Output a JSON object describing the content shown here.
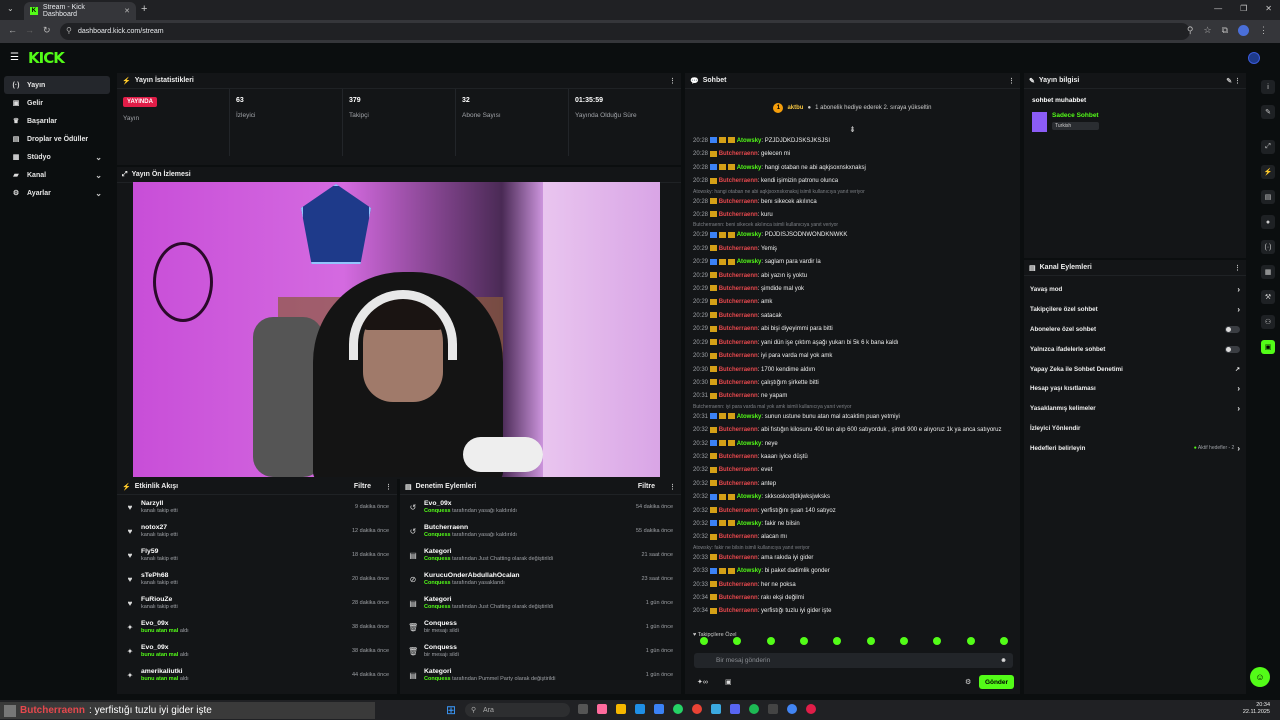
{
  "browser": {
    "tab_title": "Stream - Kick Dashboard",
    "url": "dashboard.kick.com/stream"
  },
  "logo": "KICK",
  "sidebar": {
    "items": [
      {
        "label": "Yayın",
        "icon": "(·)"
      },
      {
        "label": "Gelir",
        "icon": "▣"
      },
      {
        "label": "Başarılar",
        "icon": "♛"
      },
      {
        "label": "Droplar ve Ödüller",
        "icon": "▤"
      },
      {
        "label": "Stüdyo",
        "icon": "▦"
      },
      {
        "label": "Kanal",
        "icon": "▰"
      },
      {
        "label": "Ayarlar",
        "icon": "⚙"
      }
    ]
  },
  "stats": {
    "title": "Yayın İstatistikleri",
    "items": [
      {
        "value": "YAYINDA",
        "label": "Yayın"
      },
      {
        "value": "63",
        "label": "İzleyici"
      },
      {
        "value": "379",
        "label": "Takipçi"
      },
      {
        "value": "32",
        "label": "Abone Sayısı"
      },
      {
        "value": "01:35:59",
        "label": "Yayında Olduğu Süre"
      }
    ]
  },
  "preview": {
    "title": "Yayın Ön İzlemesi"
  },
  "activity": {
    "title": "Etkinlik Akışı",
    "filter": "Filtre",
    "rows": [
      {
        "name": "Narzyll",
        "sub": "kanalı takip etti",
        "time": "9 dakika önce",
        "icon": "♥"
      },
      {
        "name": "notox27",
        "sub": "kanalı takip etti",
        "time": "12 dakika önce",
        "icon": "♥"
      },
      {
        "name": "Fly59",
        "sub": "kanalı takip etti",
        "time": "18 dakika önce",
        "icon": "♥"
      },
      {
        "name": "sTePh68",
        "sub": "kanalı takip etti",
        "time": "20 dakika önce",
        "icon": "♥"
      },
      {
        "name": "FuRiouZe",
        "sub": "kanalı takip etti",
        "time": "28 dakika önce",
        "icon": "♥"
      },
      {
        "name": "Evo_09x",
        "sub_g": "bunu atan mal",
        "sub": "aldı",
        "time": "38 dakika önce",
        "icon": "✦"
      },
      {
        "name": "Evo_09x",
        "sub_g": "bunu atan mal",
        "sub": "aldı",
        "time": "38 dakika önce",
        "icon": "✦"
      },
      {
        "name": "amerikaliutki",
        "sub_g": "bunu atan mal",
        "sub": "aldı",
        "time": "44 dakika önce",
        "icon": "✦"
      }
    ]
  },
  "moderation": {
    "title": "Denetim Eylemleri",
    "filter": "Filtre",
    "rows": [
      {
        "name": "Evo_09x",
        "g": "Conquess",
        "sub": "tarafından yasağı kaldırıldı",
        "time": "54 dakika önce",
        "icon": "↺"
      },
      {
        "name": "Butcherraenn",
        "g": "Conquess",
        "sub": "tarafından yasağı kaldırıldı",
        "time": "55 dakika önce",
        "icon": "↺"
      },
      {
        "name": "Kategori",
        "g": "Conquess",
        "sub": "tarafından Just Chatting olarak değiştirildi",
        "time": "21 saat önce",
        "icon": "▤"
      },
      {
        "name": "KurucuOnderAbdullahOcalan",
        "g": "Conquess",
        "sub": "tarafından yasaklandı",
        "time": "23 saat önce",
        "icon": "⊘"
      },
      {
        "name": "Kategori",
        "g": "Conquess",
        "sub": "tarafından Just Chatting olarak değiştirildi",
        "time": "1 gün önce",
        "icon": "▤"
      },
      {
        "name": "Conquess",
        "g": "",
        "sub": "bir mesajı sildi",
        "time": "1 gün önce",
        "icon": "🗑"
      },
      {
        "name": "Conquess",
        "g": "",
        "sub": "bir mesajı sildi",
        "time": "1 gün önce",
        "icon": "🗑"
      },
      {
        "name": "Kategori",
        "g": "Conquess",
        "sub": "tarafından Pummel Party olarak değiştirildi",
        "time": "1 gün önce",
        "icon": "▤"
      }
    ]
  },
  "chat": {
    "title": "Sohbet",
    "top_user": "aktbu",
    "top_text": "1 abonelik hediye ederek 2. sıraya yükseltin",
    "placeholder": "Bir mesaj gönderin",
    "send": "Gönder",
    "mode": "Takipçilere Özel",
    "messages": [
      {
        "t": "20:28",
        "u": "Atowsky",
        "c": 1,
        "m": "PZJDJDKDJSKSJKSJSI"
      },
      {
        "t": "20:28",
        "u": "Butcherraenn",
        "c": 2,
        "m": "gelecen mi"
      },
      {
        "t": "20:28",
        "u": "Atowsky",
        "c": 1,
        "m": "hangi otaban ne abi aqkjsoxnskxnaksj"
      },
      {
        "t": "20:28",
        "u": "Butcherraenn",
        "c": 2,
        "m": "kendi işimizin patronu olunca"
      },
      {
        "r": "Atowsky: hangi otaban ne abi aqkjsoxnskxnaksj isimli kullanıcıya yanıt veriyor"
      },
      {
        "t": "20:28",
        "u": "Butcherraenn",
        "c": 2,
        "m": "benı sikecek akılınca"
      },
      {
        "t": "20:28",
        "u": "Butcherraenn",
        "c": 2,
        "m": "kuru"
      },
      {
        "r": "Butcherraenn: beni sikecek akılınca isimli kullanıcıya yanıt veriyor"
      },
      {
        "t": "20:29",
        "u": "Atowsky",
        "c": 1,
        "m": "PDJDISJSODNWONDKNWKK"
      },
      {
        "t": "20:29",
        "u": "Butcherraenn",
        "c": 2,
        "m": "Yemiş"
      },
      {
        "t": "20:29",
        "u": "Atowsky",
        "c": 1,
        "m": "saglam para vardir la"
      },
      {
        "t": "20:29",
        "u": "Butcherraenn",
        "c": 2,
        "m": "abi yazın iş yoktu"
      },
      {
        "t": "20:29",
        "u": "Butcherraenn",
        "c": 2,
        "m": "şimdide mal yok"
      },
      {
        "t": "20:29",
        "u": "Butcherraenn",
        "c": 2,
        "m": "amk"
      },
      {
        "t": "20:29",
        "u": "Butcherraenn",
        "c": 2,
        "m": "satacak"
      },
      {
        "t": "20:29",
        "u": "Butcherraenn",
        "c": 2,
        "m": "abi bişi diyeyimmi para bitti"
      },
      {
        "t": "20:29",
        "u": "Butcherraenn",
        "c": 2,
        "m": "yani dün işe çıktım aşağı yukarı bi 5k 6 k bana kaldı"
      },
      {
        "t": "20:30",
        "u": "Butcherraenn",
        "c": 2,
        "m": "iyi para varda mal yok amk"
      },
      {
        "t": "20:30",
        "u": "Butcherraenn",
        "c": 2,
        "m": "1700 kendime aldım"
      },
      {
        "t": "20:30",
        "u": "Butcherraenn",
        "c": 2,
        "m": "çalıştığım şirkette bitti"
      },
      {
        "t": "20:31",
        "u": "Butcherraenn",
        "c": 2,
        "m": "ne yapam"
      },
      {
        "r": "Butcherraenn: iyi para varda mal yok amk isimli kullanıcıya yanıt veriyor"
      },
      {
        "t": "20:31",
        "u": "Atowsky",
        "c": 1,
        "m": "sunun ustune bunu atan mal atcaktim puan yetmiyi"
      },
      {
        "t": "20:32",
        "u": "Butcherraenn",
        "c": 2,
        "m": "abi fıstığın kilosunu 400 ten alıp 600 satıyorduk , şimdi 900 e alıyoruz 1k ya anca satıyoruz"
      },
      {
        "t": "20:32",
        "u": "Atowsky",
        "c": 1,
        "m": "neye"
      },
      {
        "t": "20:32",
        "u": "Butcherraenn",
        "c": 2,
        "m": "kaaarı iyice düştü"
      },
      {
        "t": "20:32",
        "u": "Butcherraenn",
        "c": 2,
        "m": "evet"
      },
      {
        "t": "20:32",
        "u": "Butcherraenn",
        "c": 2,
        "m": "antep"
      },
      {
        "t": "20:32",
        "u": "Atowsky",
        "c": 1,
        "m": "skksoskod|dkjwksjwksks"
      },
      {
        "t": "20:32",
        "u": "Butcherraenn",
        "c": 2,
        "m": "yerfistığını şuan 140 satıyoz"
      },
      {
        "t": "20:32",
        "u": "Atowsky",
        "c": 1,
        "m": "fakir ne bilsin"
      },
      {
        "t": "20:32",
        "u": "Butcherraenn",
        "c": 2,
        "m": "alacan mı"
      },
      {
        "r": "Atowsky: fakir ne bilsin isimli kullanıcıya yanıt veriyor"
      },
      {
        "t": "20:33",
        "u": "Butcherraenn",
        "c": 2,
        "m": "ama rakıda iyi gider"
      },
      {
        "t": "20:33",
        "u": "Atowsky",
        "c": 1,
        "m": "bi paket dadimlik gonder"
      },
      {
        "t": "20:33",
        "u": "Butcherraenn",
        "c": 2,
        "m": "her ne poksa"
      },
      {
        "t": "20:34",
        "u": "Butcherraenn",
        "c": 2,
        "m": "rakı ekşi değilmi"
      },
      {
        "t": "20:34",
        "u": "Butcherraenn",
        "c": 2,
        "m": "yerfistığı tuzlu iyi gider işte"
      }
    ]
  },
  "streaminfo": {
    "title": "Yayın bilgisi",
    "stream_title": "sohbet muhabbet",
    "category": "Sadece Sohbet",
    "lang": "Turkish"
  },
  "actions": {
    "title": "Kanal Eylemleri",
    "items": [
      {
        "label": "Yavaş mod",
        "type": "chev"
      },
      {
        "label": "Takipçilere özel sohbet",
        "type": "chev"
      },
      {
        "label": "Abonelere özel sohbet",
        "type": "toggle"
      },
      {
        "label": "Yalnızca ifadelerle sohbet",
        "type": "toggle"
      },
      {
        "label": "Yapay Zeka ile Sohbet Denetimi",
        "type": "ext"
      },
      {
        "label": "Hesap yaşı kısıtlaması",
        "type": "chev"
      },
      {
        "label": "Yasaklanmış kelimeler",
        "type": "chev"
      },
      {
        "label": "İzleyici Yönlendir",
        "type": "none"
      },
      {
        "label": "Hedefleri belirleyin",
        "type": "goal",
        "extra": "Aktif hedefler - 2"
      }
    ]
  },
  "overlay": {
    "user": "Butcherraenn",
    "msg": ": yerfistığı tuzlu iyi gider işte"
  },
  "taskbar": {
    "search": "Ara",
    "time": "20:34",
    "date": "22.11.2025"
  }
}
